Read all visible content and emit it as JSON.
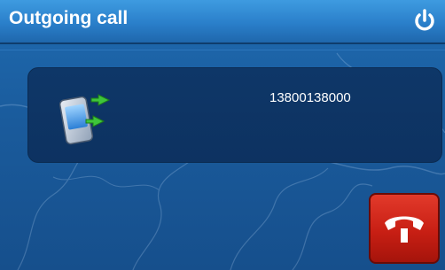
{
  "window": {
    "title": "Outgoing call"
  },
  "call": {
    "number": "13800138000"
  },
  "icons": {
    "power": "power-icon",
    "phone": "smartphone-transfer-icon",
    "end_call": "hang-up-icon"
  },
  "colors": {
    "titlebar": "#2a7fca",
    "background": "#1a5b9c",
    "panel": "#0e3768",
    "end_call_button": "#c81f14",
    "text": "#ffffff"
  }
}
